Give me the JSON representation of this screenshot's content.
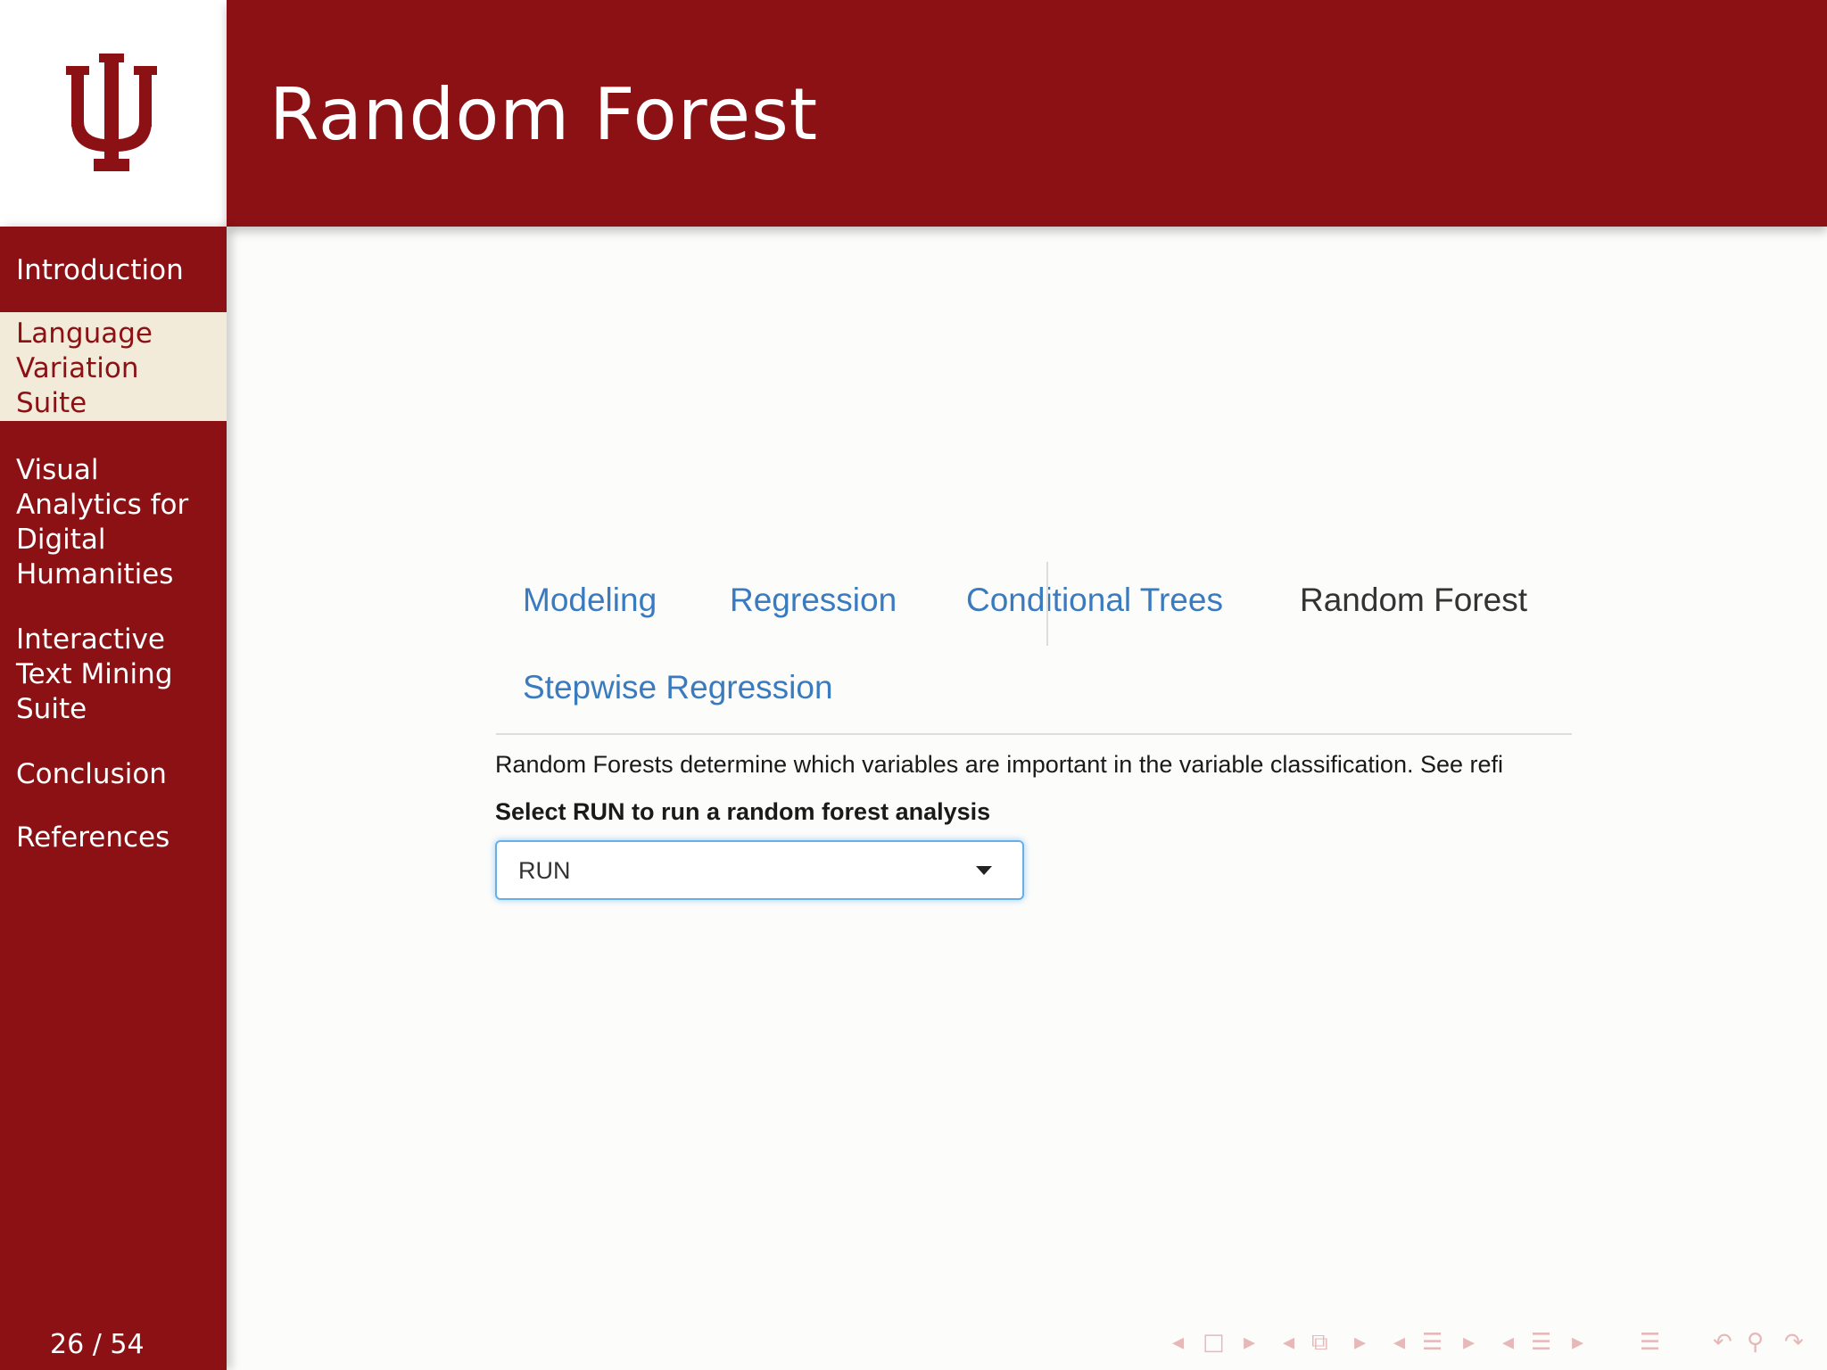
{
  "slide": {
    "title": "Random Forest",
    "logo": "indiana-university-trident"
  },
  "sidebar": {
    "items": [
      {
        "label": "Introduction",
        "active": false
      },
      {
        "label": "Language Variation Suite",
        "active": true
      },
      {
        "label": "Visual Analytics for Digital Humanities",
        "active": false
      },
      {
        "label": "Interactive Text Mining Suite",
        "active": false
      },
      {
        "label": "Conclusion",
        "active": false
      },
      {
        "label": "References",
        "active": false
      }
    ],
    "page_counter": "26 / 54"
  },
  "tabs": {
    "items": [
      {
        "label": "Modeling",
        "active": false
      },
      {
        "label": "Regression",
        "active": false
      },
      {
        "label": "Conditional Trees",
        "active": false
      },
      {
        "label": "Random Forest",
        "active": true
      },
      {
        "label": "Stepwise Regression",
        "active": false
      }
    ]
  },
  "panel": {
    "description": "Random Forests determine which variables are important in the variable classification. See refi",
    "select_label": "Select RUN to run a random forest analysis",
    "select_value": "RUN"
  },
  "colors": {
    "brand": "#8c1114",
    "active_nav_bg": "#f2ebd9",
    "tab_link": "#3a7bbf",
    "focus": "#66afe9"
  },
  "beamer_nav_icons": [
    "arrow-left-icon",
    "frame-icon",
    "arrow-right-icon",
    "arrow-left-icon",
    "subsection-icon",
    "arrow-right-icon",
    "arrow-left-icon",
    "section-icon",
    "arrow-right-icon",
    "arrow-left-icon",
    "toc-icon",
    "arrow-right-icon",
    "toc-icon",
    "undo-icon",
    "search-icon",
    "redo-icon"
  ]
}
